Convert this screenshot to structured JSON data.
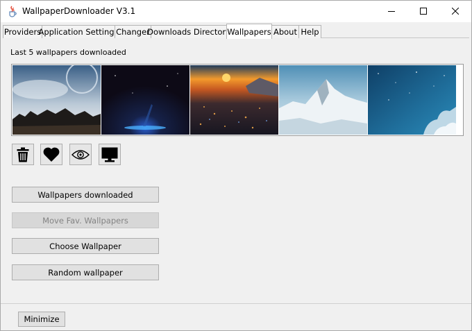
{
  "window": {
    "title": "WallpaperDownloader V3.1",
    "icon": "java-cup-icon"
  },
  "tabs": [
    {
      "label": "Providers",
      "active": false
    },
    {
      "label": "Application Settings",
      "active": false
    },
    {
      "label": "Changer",
      "active": false
    },
    {
      "label": "Downloads Directory",
      "active": false
    },
    {
      "label": "Wallpapers",
      "active": true
    },
    {
      "label": "About",
      "active": false
    },
    {
      "label": "Help",
      "active": false
    }
  ],
  "wallpapers": {
    "caption": "Last 5 wallpapers downloaded",
    "thumbnails": [
      {
        "subject": "planet-over-city"
      },
      {
        "subject": "dark-space-light"
      },
      {
        "subject": "city-sunset"
      },
      {
        "subject": "snowy-mountain"
      },
      {
        "subject": "blue-starry-sky"
      }
    ]
  },
  "icon_buttons": [
    {
      "icon": "trash-icon"
    },
    {
      "icon": "heart-icon"
    },
    {
      "icon": "eye-icon"
    },
    {
      "icon": "monitor-icon"
    }
  ],
  "actions": {
    "wallpapers_downloaded": "Wallpapers downloaded",
    "move_fav": "Move Fav. Wallpapers",
    "choose": "Choose Wallpaper",
    "random": "Random wallpaper"
  },
  "footer": {
    "minimize": "Minimize"
  },
  "colors": {
    "window_bg": "#f0f0f0",
    "button_bg": "#e1e1e1",
    "disabled_text": "#838383"
  }
}
